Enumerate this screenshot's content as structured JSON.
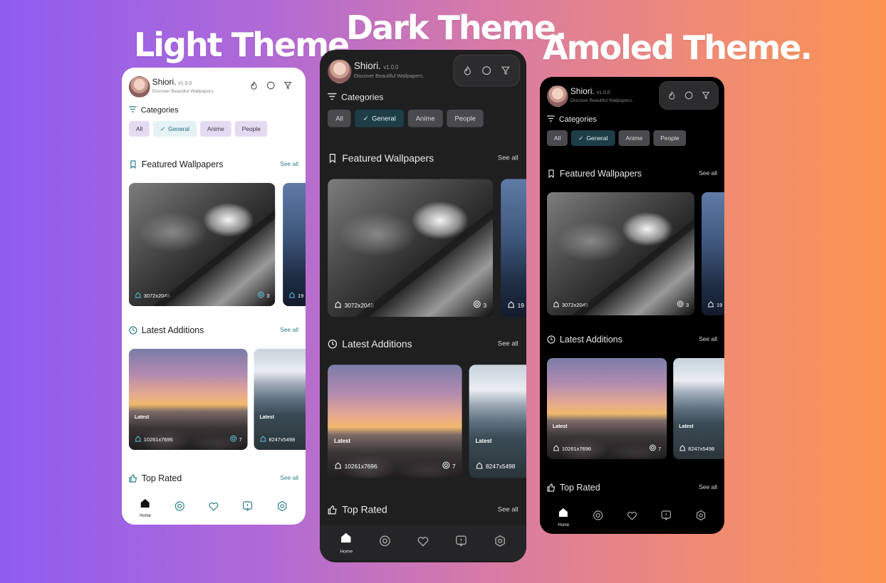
{
  "titles": {
    "light": "Light Theme",
    "dark": "Dark Theme.",
    "amoled": "Amoled Theme."
  },
  "app": {
    "name": "Shiori.",
    "version": "v1.0.0",
    "tagline": "Discover Beautiful Wallpapers."
  },
  "header_icons": [
    "fire-icon",
    "search-icon",
    "filter-icon"
  ],
  "categories": {
    "title": "Categories",
    "chips": [
      {
        "label": "All",
        "selected": false
      },
      {
        "label": "General",
        "selected": true
      },
      {
        "label": "Anime",
        "selected": false
      },
      {
        "label": "People",
        "selected": false
      }
    ]
  },
  "sections": {
    "featured": {
      "title": "Featured Wallpapers",
      "see_all": "See all"
    },
    "latest": {
      "title": "Latest Additions",
      "see_all": "See all"
    },
    "top_rated": {
      "title": "Top Rated",
      "see_all": "See all"
    }
  },
  "featured_cards": [
    {
      "resolution": "3072x2048",
      "likes": "3"
    },
    {
      "resolution": "19"
    }
  ],
  "latest_cards": [
    {
      "tag": "Latest",
      "resolution": "10261x7696",
      "likes": "7"
    },
    {
      "tag": "Latest",
      "resolution": "8247x5498"
    }
  ],
  "nav": [
    {
      "icon": "home-icon",
      "label": "Home",
      "active": true
    },
    {
      "icon": "explore-icon",
      "label": "",
      "active": false
    },
    {
      "icon": "heart-icon",
      "label": "",
      "active": false
    },
    {
      "icon": "info-icon",
      "label": "",
      "active": false
    },
    {
      "icon": "settings-icon",
      "label": "",
      "active": false
    }
  ],
  "colors": {
    "light_bg": "#ffffff",
    "dark_bg": "#1f1f20",
    "amoled_bg": "#000000",
    "light_accent": "#2d7f8c",
    "dark_chip_selected": "#1d3d47"
  }
}
